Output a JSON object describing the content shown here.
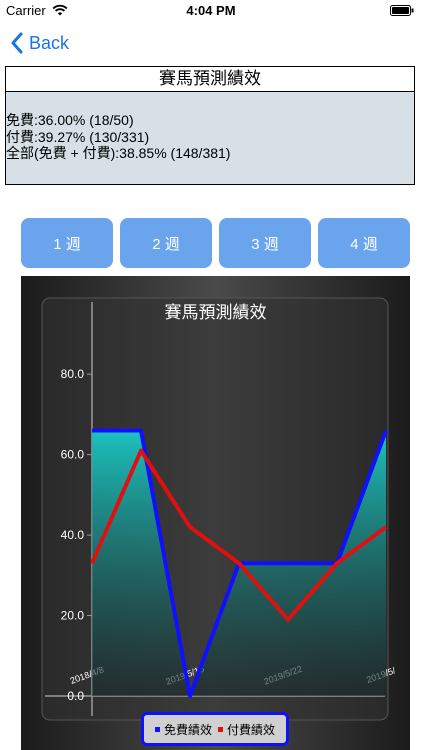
{
  "status_bar": {
    "carrier": "Carrier",
    "time": "4:04 PM"
  },
  "nav": {
    "back_label": "Back"
  },
  "page": {
    "title": "賽馬預測績效",
    "stats": [
      "免費:36.00% (18/50)",
      "付費:39.27% (130/331)",
      "全部(免費 + 付費):38.85% (148/381)"
    ]
  },
  "week_buttons": [
    "1 週",
    "2 週",
    "3 週",
    "4 週"
  ],
  "colors": {
    "accent": "#1a73e8",
    "button": "#6aa4ec",
    "stats_bg": "#d6e0e6",
    "free_series": "#1010ff",
    "paid_series": "#e01010"
  },
  "chart_data": {
    "type": "line",
    "title": "賽馬預測績效",
    "x": [
      "2018/4/8",
      "",
      "2019/5/15",
      "",
      "2019/5/22",
      "",
      "2019/5/"
    ],
    "x_positions": [
      0,
      1,
      2,
      3,
      4,
      5,
      6
    ],
    "tick_labels_x": [
      "2018/4/8",
      "2019/5/15",
      "2019/5/22",
      "2019/5/"
    ],
    "y_ticks": [
      "0.0",
      "20.0",
      "40.0",
      "60.0",
      "80.0"
    ],
    "ylim": [
      0,
      88
    ],
    "series": [
      {
        "name": "免費績效",
        "values": [
          66,
          66,
          0,
          33,
          33,
          33,
          66
        ],
        "fill": true
      },
      {
        "name": "付費績效",
        "values": [
          33,
          61,
          42,
          33,
          19,
          33,
          42
        ]
      }
    ],
    "legend": "bottom-center",
    "grid": false
  }
}
